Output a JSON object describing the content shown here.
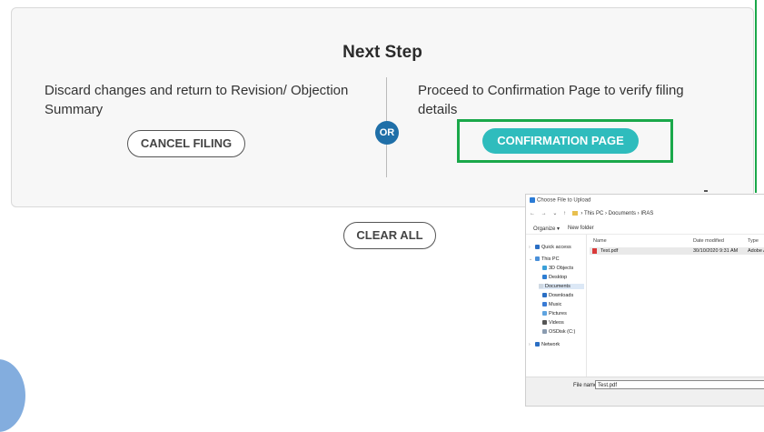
{
  "panel": {
    "title": "Next Step",
    "left_text": "Discard changes and return to Revision/ Objection Summary",
    "right_text": "Proceed to Confirmation Page to verify filing details",
    "or_label": "OR",
    "cancel_label": "CANCEL FILING",
    "confirm_label": "CONFIRMATION PAGE",
    "accent_color": "#2fbcbd",
    "highlight_color": "#1aa84a"
  },
  "clear_all_label": "CLEAR ALL",
  "dialog": {
    "title": "Choose File to Upload",
    "breadcrumb": [
      "This PC",
      "Documents",
      "IRAS"
    ],
    "toolbar": {
      "organize": "Organize ▾",
      "new_folder": "New folder"
    },
    "sidebar": [
      {
        "label": "Quick access",
        "icon": "star-icon"
      },
      {
        "label": "This PC",
        "icon": "computer-icon"
      },
      {
        "label": "3D Objects",
        "icon": "cube-icon"
      },
      {
        "label": "Desktop",
        "icon": "desktop-icon"
      },
      {
        "label": "Documents",
        "icon": "documents-icon"
      },
      {
        "label": "Downloads",
        "icon": "download-icon"
      },
      {
        "label": "Music",
        "icon": "music-icon"
      },
      {
        "label": "Pictures",
        "icon": "pictures-icon"
      },
      {
        "label": "Videos",
        "icon": "video-icon"
      },
      {
        "label": "OSDisk (C:)",
        "icon": "disk-icon"
      },
      {
        "label": "Network",
        "icon": "network-icon"
      }
    ],
    "columns": [
      "Name",
      "Date modified",
      "Type"
    ],
    "files": [
      {
        "name": "Test.pdf",
        "date": "30/10/2020 9:31 AM",
        "type": "Adobe A"
      }
    ],
    "file_name_label": "File name:",
    "file_name_value": "Test.pdf"
  }
}
